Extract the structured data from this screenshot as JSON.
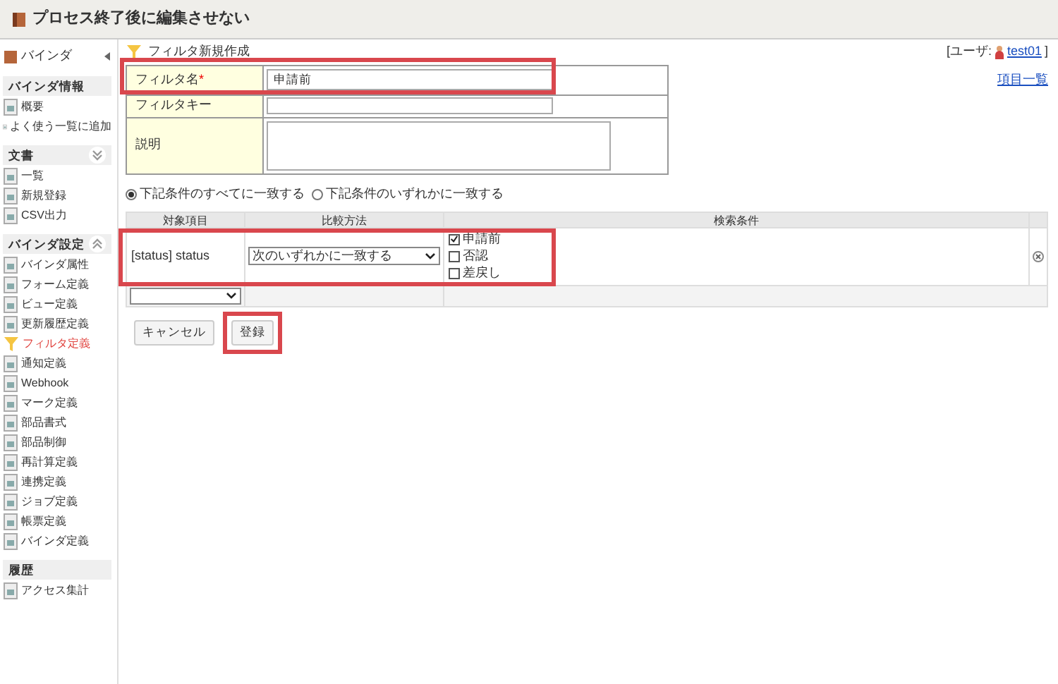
{
  "window": {
    "title": "プロセス終了後に編集させない"
  },
  "sidebar": {
    "header": "バインダ",
    "sections": [
      {
        "title": "バインダ情報",
        "kind": "plain",
        "items": [
          {
            "label": "概要",
            "selected": false
          },
          {
            "label": "よく使う一覧に追加",
            "selected": false
          }
        ]
      },
      {
        "title": "文書",
        "kind": "down",
        "items": [
          {
            "label": "一覧",
            "selected": false
          },
          {
            "label": "新規登録",
            "selected": false
          },
          {
            "label": "CSV出力",
            "selected": false
          }
        ]
      },
      {
        "title": "バインダ設定",
        "kind": "up",
        "items": [
          {
            "label": "バインダ属性",
            "selected": false
          },
          {
            "label": "フォーム定義",
            "selected": false
          },
          {
            "label": "ビュー定義",
            "selected": false
          },
          {
            "label": "更新履歴定義",
            "selected": false
          },
          {
            "label": "フィルタ定義",
            "selected": true
          },
          {
            "label": "通知定義",
            "selected": false
          },
          {
            "label": "Webhook",
            "selected": false
          },
          {
            "label": "マーク定義",
            "selected": false
          },
          {
            "label": "部品書式",
            "selected": false
          },
          {
            "label": "部品制御",
            "selected": false
          },
          {
            "label": "再計算定義",
            "selected": false
          },
          {
            "label": "連携定義",
            "selected": false
          },
          {
            "label": "ジョブ定義",
            "selected": false
          },
          {
            "label": "帳票定義",
            "selected": false
          },
          {
            "label": "バインダ定義",
            "selected": false
          }
        ]
      },
      {
        "title": "履歴",
        "kind": "plain",
        "items": [
          {
            "label": "アクセス集計",
            "selected": false
          }
        ]
      }
    ]
  },
  "page": {
    "title": "フィルタ新規作成",
    "user_label": "[ユーザ:",
    "user_name": "test01",
    "user_close": "]",
    "items_link": "項目一覧"
  },
  "form": {
    "name_label": "フィルタ名",
    "required_mark": "*",
    "name_value": "申請前",
    "key_label": "フィルタキー",
    "description_label": "説明"
  },
  "match_options": [
    {
      "label": "下記条件のすべてに一致する",
      "selected": true
    },
    {
      "label": "下記条件のいずれかに一致する",
      "selected": false
    }
  ],
  "conditions": {
    "columns": [
      "対象項目",
      "比較方法",
      "検索条件"
    ],
    "rows": [
      {
        "field": "[status] status",
        "method": "次のいずれかに一致する",
        "options": [
          {
            "label": "申請前",
            "checked": true
          },
          {
            "label": "否認",
            "checked": false
          },
          {
            "label": "差戻し",
            "checked": false
          }
        ]
      }
    ]
  },
  "buttons": [
    {
      "label": "キャンセル",
      "highlighted": false
    },
    {
      "label": "登録",
      "highlighted": true
    }
  ]
}
